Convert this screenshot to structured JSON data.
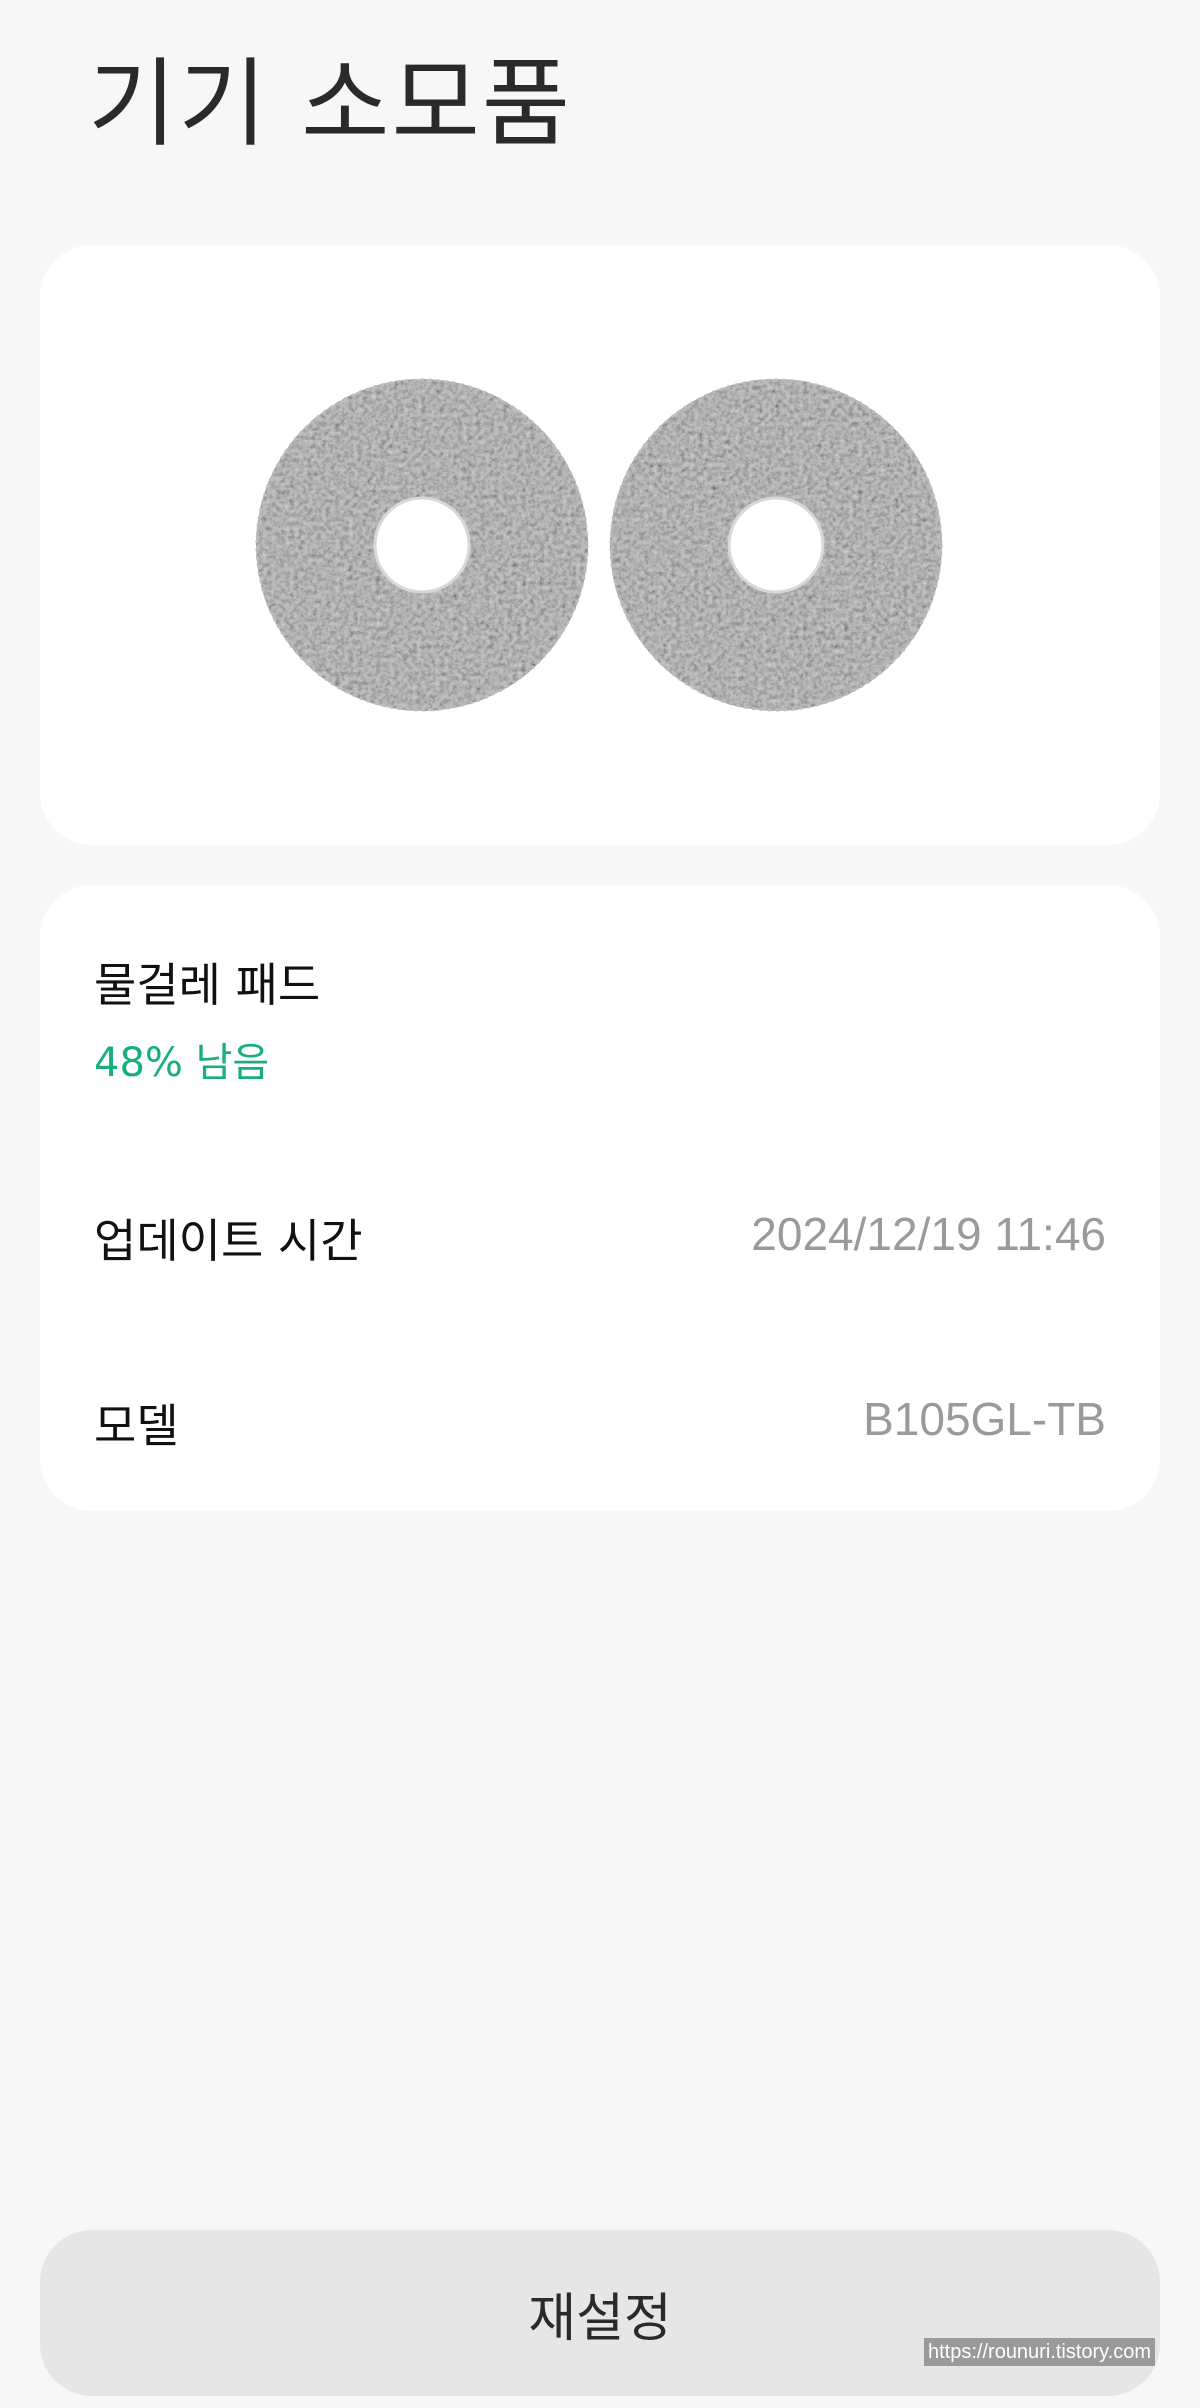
{
  "header": {
    "title": "기기 소모품"
  },
  "product_image": {
    "icon": "mop-pads-image"
  },
  "consumable": {
    "name": "물걸레 패드",
    "remaining_text": "48% 남음",
    "remaining_fraction": 0.48,
    "status_color": "#17b07a"
  },
  "details": {
    "update_label": "업데이트 시간",
    "update_value": "2024/12/19 11:46",
    "model_label": "모델",
    "model_value": "B105GL-TB"
  },
  "actions": {
    "reset_label": "재설정"
  },
  "watermark": "https://rounuri.tistory.com"
}
